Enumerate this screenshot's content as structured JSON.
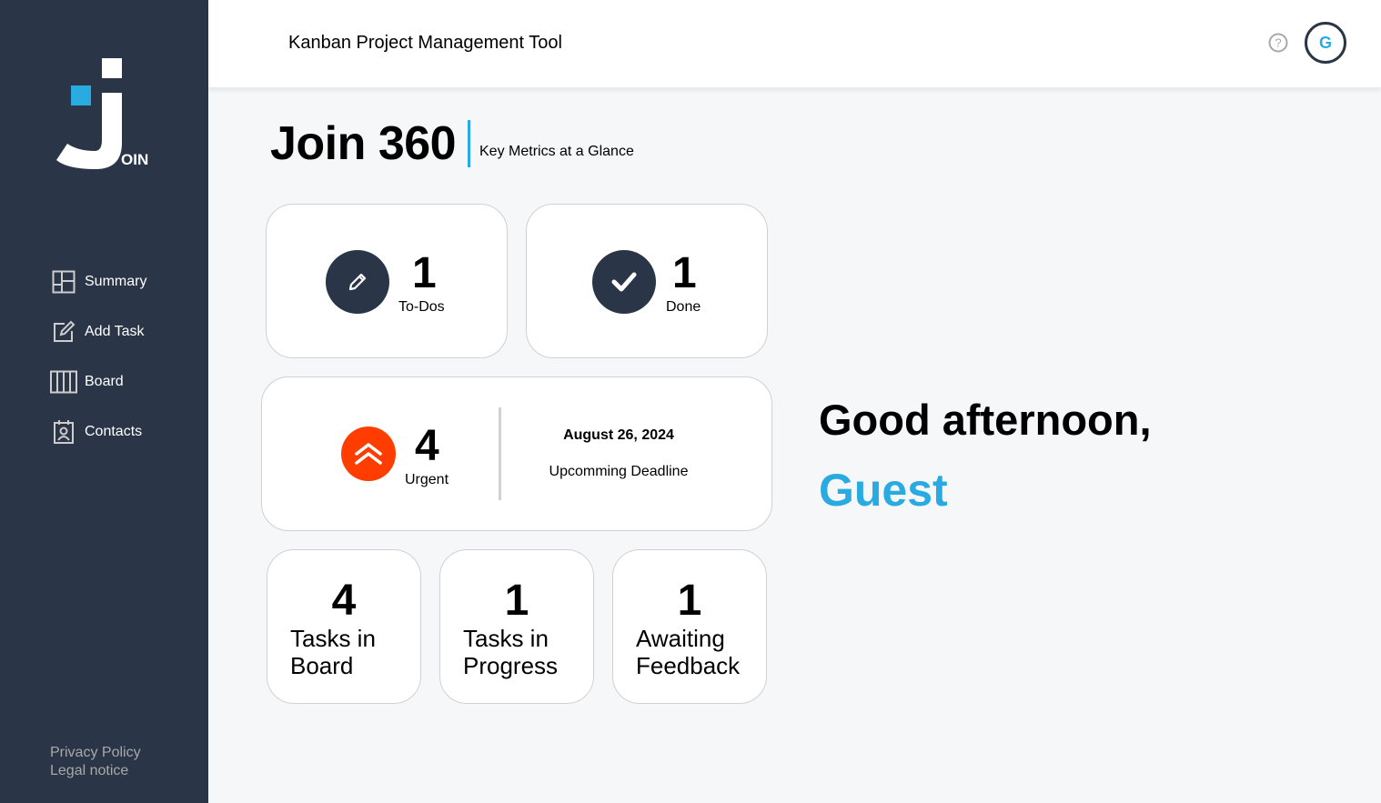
{
  "app": {
    "header_title": "Kanban Project Management Tool",
    "avatar_initial": "G",
    "logo_text": "OIN"
  },
  "sidebar": {
    "items": [
      {
        "label": "Summary",
        "icon": "summary-icon"
      },
      {
        "label": "Add Task",
        "icon": "add-task-icon"
      },
      {
        "label": "Board",
        "icon": "board-icon"
      },
      {
        "label": "Contacts",
        "icon": "contacts-icon"
      }
    ],
    "privacy": "Privacy Policy",
    "legal": "Legal notice"
  },
  "page": {
    "title": "Join 360",
    "subtitle": "Key Metrics at a Glance"
  },
  "metrics": {
    "todo": {
      "count": "1",
      "label": "To-Dos"
    },
    "done": {
      "count": "1",
      "label": "Done"
    },
    "urgent": {
      "count": "4",
      "label": "Urgent"
    },
    "deadline": {
      "date": "August 26, 2024",
      "label": "Upcomming Deadline"
    },
    "board": {
      "count": "4",
      "label_line1": "Tasks in",
      "label_line2": "Board"
    },
    "progress": {
      "count": "1",
      "label_line1": "Tasks in",
      "label_line2": "Progress"
    },
    "feedback": {
      "count": "1",
      "label_line1": "Awaiting",
      "label_line2": "Feedback"
    }
  },
  "greeting": {
    "text": "Good afternoon,",
    "name": "Guest"
  },
  "colors": {
    "sidebar": "#2a3647",
    "accent": "#29abe2",
    "urgent": "#ff3d00"
  }
}
